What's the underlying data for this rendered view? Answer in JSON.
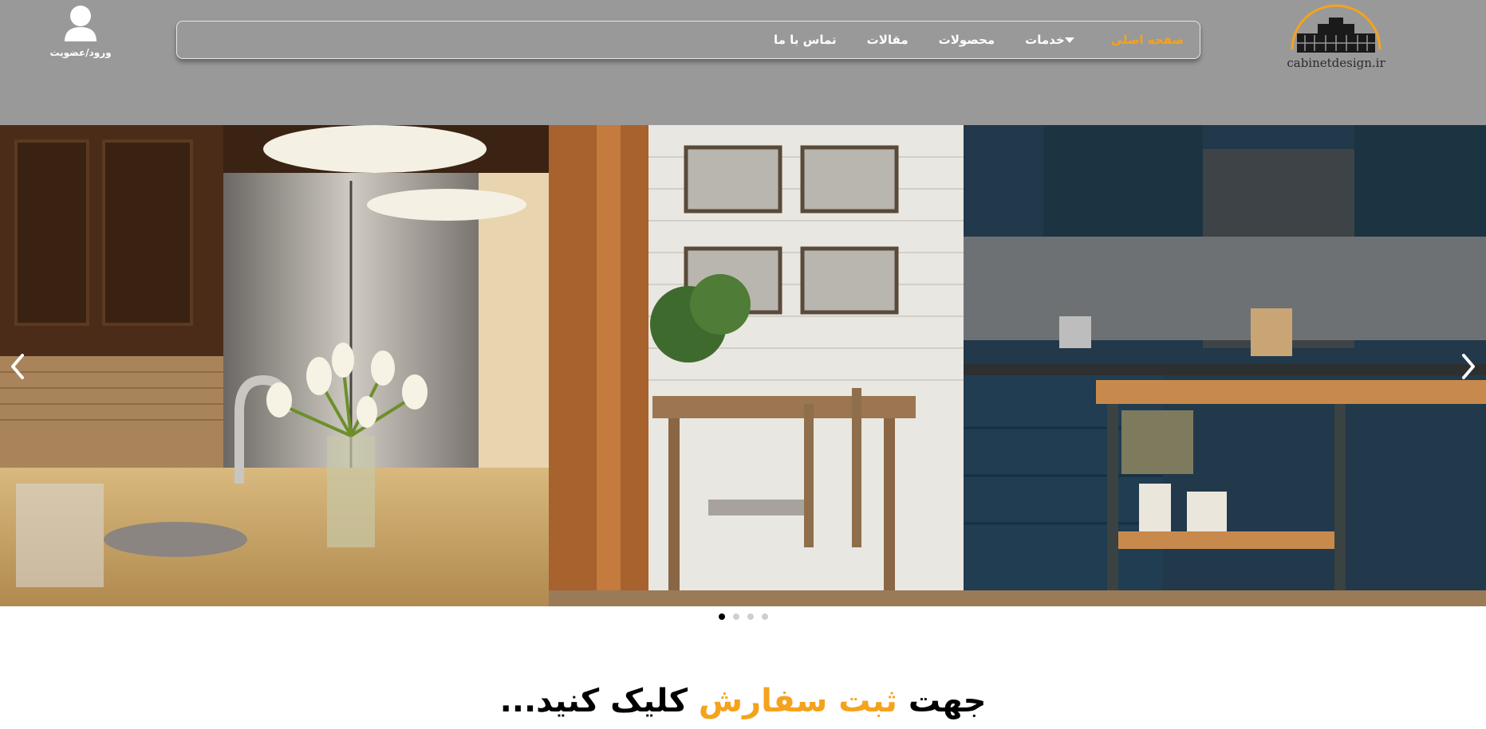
{
  "header": {
    "logo_text": "cabinetdesign.ir",
    "nav": [
      {
        "label": "صفحه اصلی",
        "active": true
      },
      {
        "label": "خدمات",
        "has_dropdown": true
      },
      {
        "label": "محصولات"
      },
      {
        "label": "مقالات"
      },
      {
        "label": "تماس با ما"
      }
    ],
    "user_label": "ورود/عضویت"
  },
  "slider": {
    "slides": [
      "kitchen-granite-flowers",
      "kitchen-blue-cabinets-dining"
    ],
    "dots": 4,
    "active_dot": 1
  },
  "cta": {
    "part1": "جهت",
    "highlight": "ثبت سفارش",
    "part2": "کلیک کنید..."
  },
  "colors": {
    "header_bg": "#999999",
    "accent": "#f5a21c",
    "text_light": "#ffffff"
  }
}
